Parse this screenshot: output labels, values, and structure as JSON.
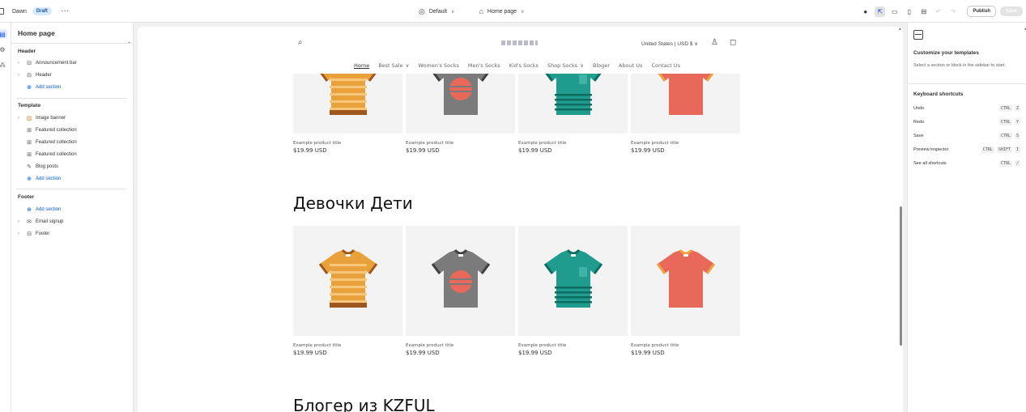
{
  "topbar": {
    "theme_name": "Dawn",
    "badge": "Draft",
    "more": "···",
    "preset": "Default",
    "page": "Home page",
    "publish": "Publish",
    "save": "Save"
  },
  "sidebar": {
    "title": "Home page",
    "groups": [
      {
        "label": "Header",
        "items": [
          {
            "label": "Announcement bar",
            "icon": "layout-icon",
            "expandable": true
          },
          {
            "label": "Header",
            "icon": "layout-icon",
            "expandable": true
          },
          {
            "label": "Add section",
            "icon": "plus-circle-icon",
            "add": true
          }
        ]
      },
      {
        "label": "Template",
        "items": [
          {
            "label": "Image banner",
            "icon": "image-icon",
            "expandable": true
          },
          {
            "label": "Featured collection",
            "icon": "grid-icon"
          },
          {
            "label": "Featured collection",
            "icon": "grid-icon"
          },
          {
            "label": "Featured collection",
            "icon": "grid-icon"
          },
          {
            "label": "Blog posts",
            "icon": "edit-icon"
          },
          {
            "label": "Add section",
            "icon": "plus-circle-icon",
            "add": true
          }
        ]
      },
      {
        "label": "Footer",
        "items": [
          {
            "label": "Add section",
            "icon": "plus-circle-icon",
            "add": true
          },
          {
            "label": "Email signup",
            "icon": "email-icon",
            "expandable": true
          },
          {
            "label": "Footer",
            "icon": "layout-icon",
            "expandable": true
          }
        ]
      }
    ]
  },
  "preview": {
    "country": "United States | USD $",
    "nav": [
      "Home",
      "Best Sale",
      "Women's Socks",
      "Men's Socks",
      "Kid's Socks",
      "Shop Socks",
      "Bloger",
      "About Us",
      "Contact Us"
    ],
    "nav_dropdowns": [
      false,
      true,
      false,
      false,
      false,
      true,
      false,
      false,
      false
    ],
    "product_title": "Example product title",
    "product_price": "$19.99 USD",
    "section2_heading": "Девочки Дети",
    "section3_heading": "Блогер из KZFUL",
    "shirt_colors": [
      "#e9a23b",
      "#7b7b7b",
      "#1f9c8d",
      "#e8695a"
    ]
  },
  "right_panel": {
    "title": "Customize your templates",
    "description": "Select a section or block in the sidebar to start.",
    "shortcuts_title": "Keyboard shortcuts",
    "shortcuts": [
      {
        "action": "Undo",
        "keys": [
          "CTRL",
          "Z"
        ]
      },
      {
        "action": "Redo",
        "keys": [
          "CTRL",
          "Y"
        ]
      },
      {
        "action": "Save",
        "keys": [
          "CTRL",
          "S"
        ]
      },
      {
        "action": "Preview inspector",
        "keys": [
          "CTRL",
          "SHIFT",
          "I"
        ]
      },
      {
        "action": "See all shortcuts",
        "keys": [
          "CTRL",
          "/"
        ]
      }
    ]
  }
}
